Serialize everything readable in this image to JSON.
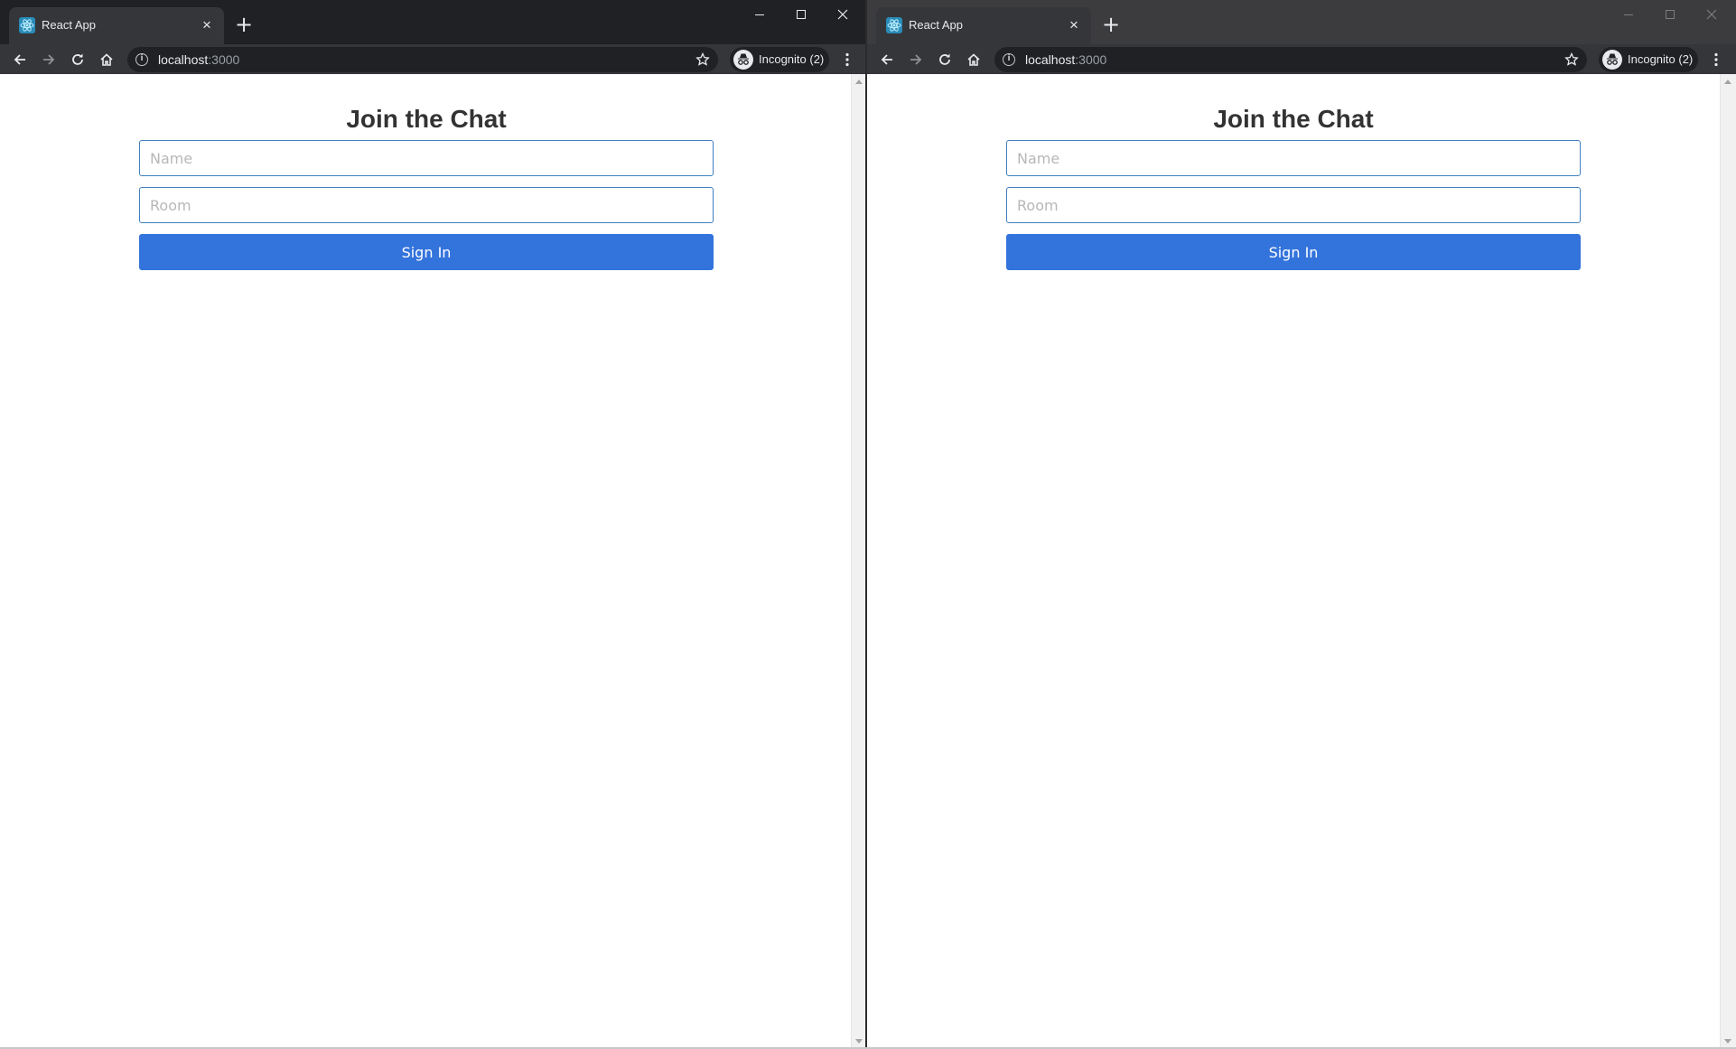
{
  "windows": [
    {
      "tab_title": "React App",
      "url_host": "localhost",
      "url_port": ":3000",
      "incognito_label": "Incognito (2)",
      "page_title": "Join the Chat",
      "name_placeholder": "Name",
      "room_placeholder": "Room",
      "signin_label": "Sign In",
      "favicon_icon": "react-icon",
      "accent_color": "#3373dc"
    },
    {
      "tab_title": "React App",
      "url_host": "localhost",
      "url_port": ":3000",
      "incognito_label": "Incognito (2)",
      "page_title": "Join the Chat",
      "name_placeholder": "Name",
      "room_placeholder": "Room",
      "signin_label": "Sign In",
      "favicon_icon": "react-icon",
      "accent_color": "#3373dc"
    }
  ],
  "icons": {
    "tab_close": "×",
    "new_tab": "+"
  }
}
